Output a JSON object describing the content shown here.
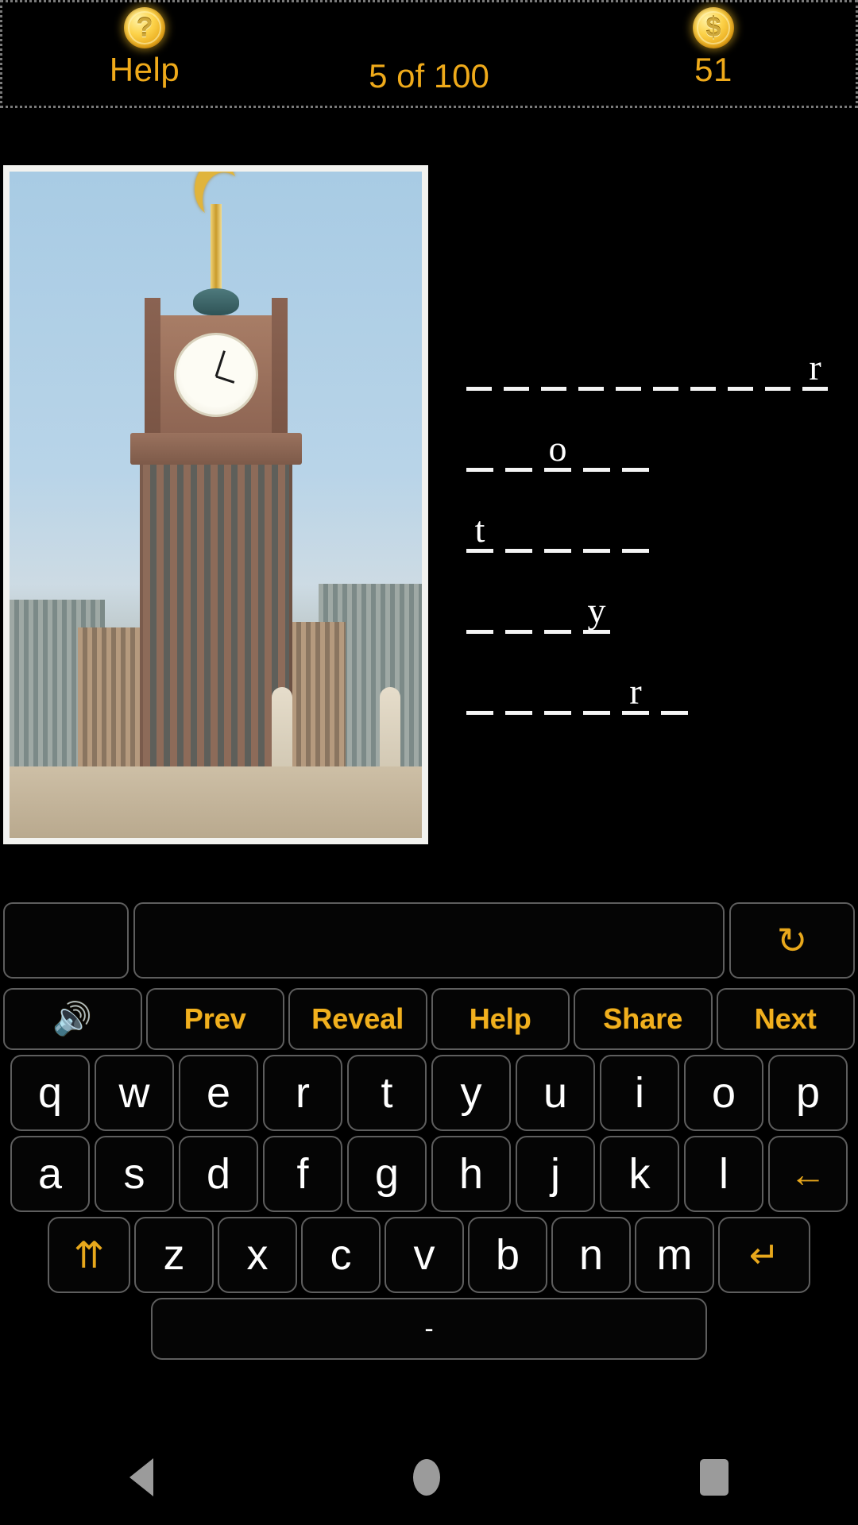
{
  "header": {
    "help": {
      "label": "Help",
      "icon": "question-coin-icon",
      "glyph": "?"
    },
    "progress": "5 of 100",
    "coins": {
      "count": "51",
      "icon": "dollar-coin-icon",
      "glyph": "$"
    }
  },
  "puzzle": {
    "image_alt": "Abraj Al-Bait clock tower photograph",
    "lines": [
      {
        "length": 10,
        "letters": [
          "",
          "",
          "",
          "",
          "",
          "",
          "",
          "",
          "",
          "r"
        ]
      },
      {
        "length": 5,
        "letters": [
          "",
          "",
          "o",
          "",
          ""
        ]
      },
      {
        "length": 5,
        "letters": [
          "t",
          "",
          "",
          "",
          ""
        ]
      },
      {
        "length": 4,
        "letters": [
          "",
          "",
          "",
          "y"
        ]
      },
      {
        "length": 6,
        "letters": [
          "",
          "",
          "",
          "",
          "r",
          ""
        ]
      }
    ]
  },
  "answer": {
    "value": "",
    "placeholder": "",
    "reset_icon": "refresh-icon",
    "reset_glyph": "↻"
  },
  "actions": [
    {
      "name": "sound",
      "label": "🔊",
      "is_icon": true
    },
    {
      "name": "prev",
      "label": "Prev",
      "is_icon": false
    },
    {
      "name": "reveal",
      "label": "Reveal",
      "is_icon": false
    },
    {
      "name": "help",
      "label": "Help",
      "is_icon": false
    },
    {
      "name": "share",
      "label": "Share",
      "is_icon": false
    },
    {
      "name": "next",
      "label": "Next",
      "is_icon": false
    }
  ],
  "keyboard": {
    "row1": [
      "q",
      "w",
      "e",
      "r",
      "t",
      "y",
      "u",
      "i",
      "o",
      "p"
    ],
    "row2": [
      "a",
      "s",
      "d",
      "f",
      "g",
      "h",
      "j",
      "k",
      "l"
    ],
    "backspace": "←",
    "row3": [
      "z",
      "x",
      "c",
      "v",
      "b",
      "n",
      "m"
    ],
    "shift": "⇈",
    "enter": "↵",
    "space": "-"
  },
  "navbar": {
    "back": "back-button",
    "home": "home-button",
    "recent": "recent-apps-button"
  },
  "colors": {
    "accent": "#efaa1a",
    "background": "#000000",
    "key_text": "#ffffff",
    "key_border": "#5e5e5e",
    "blank_line": "#f4f4f4"
  }
}
